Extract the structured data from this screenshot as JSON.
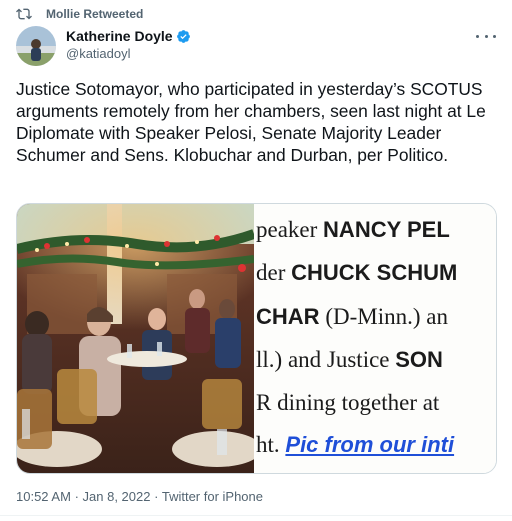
{
  "retweet": {
    "label": "Mollie Retweeted",
    "icon": "retweet-icon"
  },
  "author": {
    "name": "Katherine Doyle",
    "handle": "@katiadoyl",
    "verified": true,
    "verified_color": "#1d9bf0"
  },
  "tweet": {
    "text": "Justice Sotomayor, who participated in yesterday’s SCOTUS arguments remotely from her chambers, seen last night at Le Diplomate with Speaker Pelosi, Senate Majority Leader Schumer and Sens. Klobuchar and Durban, per Politico."
  },
  "clipping": {
    "line1": {
      "pre": "peaker ",
      "bold": "NANCY PEL"
    },
    "line2": {
      "pre": "der ",
      "bold": "CHUCK SCHUM"
    },
    "line3": {
      "bold": "CHAR",
      "post": " (D-Minn.) an"
    },
    "line4": {
      "pre": "ll.) and Justice ",
      "bold": "SON"
    },
    "line5": {
      "pre": "R dining together at "
    },
    "line6": {
      "pre": "ht. ",
      "link": "Pic from our inti"
    }
  },
  "meta": {
    "time": "10:52 AM",
    "separator1": "·",
    "date": "Jan 8, 2022",
    "separator2": "·",
    "source": "Twitter for iPhone"
  },
  "colors": {
    "secondary_text": "#536471",
    "link": "#1f4fd8"
  }
}
